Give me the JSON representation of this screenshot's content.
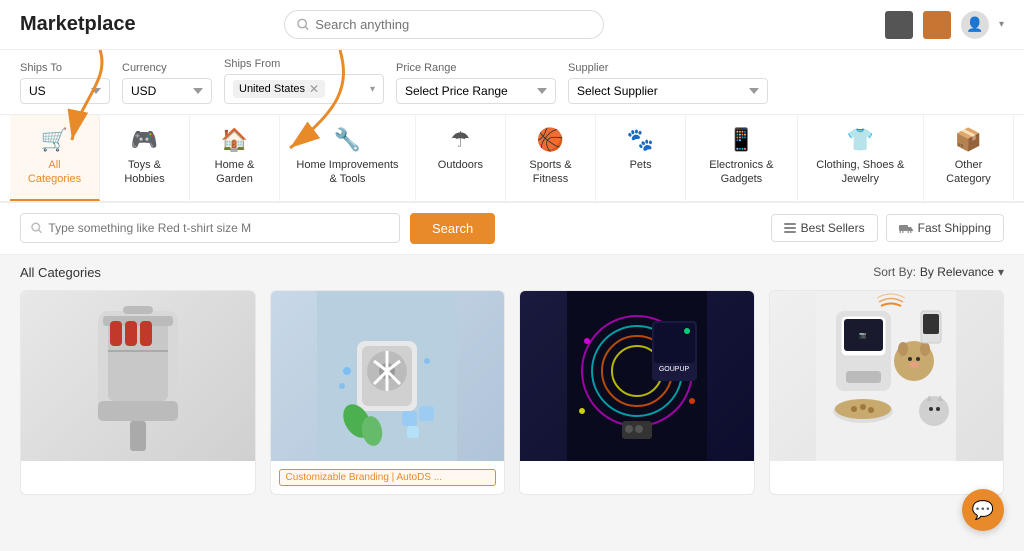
{
  "header": {
    "logo": "Marketplace",
    "search_placeholder": "Search anything"
  },
  "filters": {
    "ships_to_label": "Ships To",
    "ships_to_value": "US",
    "currency_label": "Currency",
    "currency_value": "USD",
    "ships_from_label": "Ships From",
    "ships_from_tag": "United States",
    "price_range_label": "Price Range",
    "price_range_placeholder": "Select Price Range",
    "supplier_label": "Supplier",
    "supplier_placeholder": "Select Supplier"
  },
  "categories": [
    {
      "id": "all",
      "icon": "🛒",
      "label": "All Categories",
      "active": true
    },
    {
      "id": "toys",
      "icon": "🎮",
      "label": "Toys & Hobbies",
      "active": false
    },
    {
      "id": "home",
      "icon": "🏠",
      "label": "Home & Garden",
      "active": false
    },
    {
      "id": "improvements",
      "icon": "🔧",
      "label": "Home Improvements & Tools",
      "active": false
    },
    {
      "id": "outdoors",
      "icon": "☂",
      "label": "Outdoors",
      "active": false
    },
    {
      "id": "sports",
      "icon": "🏀",
      "label": "Sports & Fitness",
      "active": false
    },
    {
      "id": "pets",
      "icon": "🐾",
      "label": "Pets",
      "active": false
    },
    {
      "id": "electronics",
      "icon": "📱",
      "label": "Electronics & Gadgets",
      "active": false
    },
    {
      "id": "clothing",
      "icon": "👕",
      "label": "Clothing, Shoes & Jewelry",
      "active": false
    },
    {
      "id": "other",
      "icon": "📦",
      "label": "Other Category",
      "active": false
    }
  ],
  "search_row": {
    "placeholder": "Type something like Red t-shirt size M",
    "search_btn": "Search",
    "best_sellers_btn": "Best Sellers",
    "fast_shipping_btn": "Fast Shipping"
  },
  "content": {
    "title": "All Categories",
    "sort_label": "Sort By:",
    "sort_value": "By Relevance"
  },
  "products": [
    {
      "id": 1,
      "type": "cooler-bag",
      "badge": null
    },
    {
      "id": 2,
      "type": "fan",
      "badge": "Customizable Branding | AutoDS ..."
    },
    {
      "id": 3,
      "type": "led",
      "badge": null
    },
    {
      "id": 4,
      "type": "pet-feeder",
      "badge": null
    }
  ],
  "colors": {
    "accent": "#e8892a",
    "dark_box": "#555555",
    "orange_box": "#c87533"
  }
}
